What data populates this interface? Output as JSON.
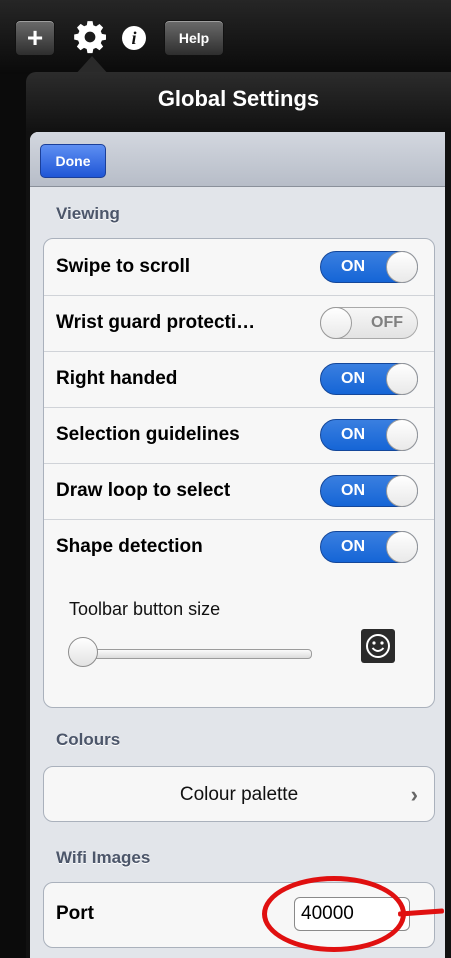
{
  "toolbar": {
    "plus_label": "+",
    "help_label": "Help",
    "info_label": "i",
    "icons": [
      "plus-icon",
      "gear-icon",
      "info-icon"
    ]
  },
  "popover": {
    "title": "Global Settings",
    "done_label": "Done"
  },
  "viewing": {
    "header": "Viewing",
    "toggles": [
      {
        "label": "Swipe to scroll",
        "state": "ON"
      },
      {
        "label": "Wrist guard protecti…",
        "state": "OFF"
      },
      {
        "label": "Right handed",
        "state": "ON"
      },
      {
        "label": "Selection guidelines",
        "state": "ON"
      },
      {
        "label": "Draw loop to select",
        "state": "ON"
      },
      {
        "label": "Shape detection",
        "state": "ON"
      }
    ],
    "slider": {
      "label": "Toolbar button size",
      "value": 0.0,
      "icon": "smiley-icon"
    }
  },
  "colours": {
    "header": "Colours",
    "palette_label": "Colour palette",
    "chevron": "›"
  },
  "wifi": {
    "header": "Wifi Images",
    "port_label": "Port",
    "port_value": "40000"
  },
  "colors": {
    "switch_on": "#1565d6",
    "done_button": "#1f56d6",
    "annotation": "#e01010"
  }
}
